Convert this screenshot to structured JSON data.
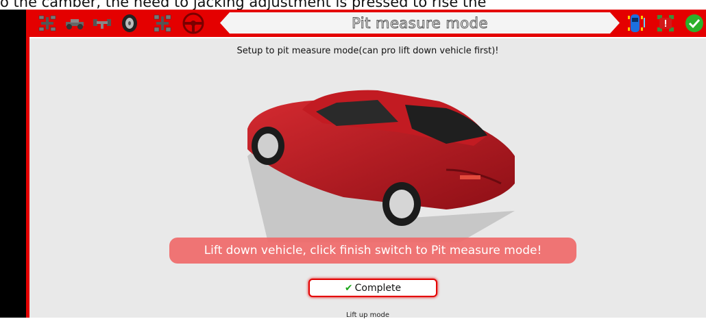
{
  "caption": "o the camber, the need to jacking adjustment is pressed to rise the",
  "toolbar": {
    "title": "Pit measure mode",
    "left_icons": [
      "axle-lift-icon",
      "vehicle-side-icon",
      "axle-top-icon",
      "tire-icon",
      "axle-frame-icon",
      "steering-wheel-icon"
    ],
    "right_icons": [
      "vehicle-status-icon",
      "vehicle-warning-icon",
      "confirm-check-icon"
    ],
    "colors": {
      "accent": "#e40000",
      "confirm": "#2bb02b",
      "status": "#1d6fe0"
    }
  },
  "main": {
    "instruction": "Setup to pit measure mode(can pro lift down vehicle first)!",
    "banner": "Lift down vehicle, click finish switch to Pit measure mode!",
    "complete_label": "Complete",
    "lift_up_label": "Lift up mode"
  },
  "car": {
    "color": "#b3141e",
    "description_icon": "red-sedan-image"
  }
}
